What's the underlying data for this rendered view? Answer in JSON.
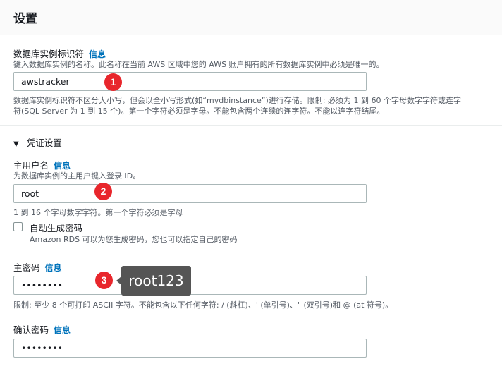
{
  "page": {
    "title": "设置"
  },
  "db_identifier": {
    "label": "数据库实例标识符",
    "info": "信息",
    "hint": "键入数据库实例的名称。此名称在当前 AWS 区域中您的 AWS 账户拥有的所有数据库实例中必须是唯一的。",
    "value": "awstracker",
    "constraint_line1": "数据库实例标识符不区分大小写，但会以全小写形式(如“mydbinstance”)进行存储。限制: 必须为 1 到 60 个字母数字字符或连字",
    "constraint_line2": "符(SQL Server 为 1 到 15 个)。第一个字符必须是字母。不能包含两个连续的连字符。不能以连字符结尾。"
  },
  "credentials": {
    "section_title": "凭证设置",
    "master_username": {
      "label": "主用户名",
      "info": "信息",
      "hint": "为数据库实例的主用户键入登录 ID。",
      "value": "root",
      "constraint": "1 到 16 个字母数字字符。第一个字符必须是字母"
    },
    "auto_generate": {
      "label": "自动生成密码",
      "hint": "Amazon RDS 可以为您生成密码，您也可以指定自己的密码",
      "checked": false
    },
    "master_password": {
      "label": "主密码",
      "info": "信息",
      "value": "••••••••",
      "constraint": "限制: 至少 8 个可打印 ASCII 字符。不能包含以下任何字符: / (斜杠)、' (单引号)、\" (双引号)和 @ (at 符号)。"
    },
    "confirm_password": {
      "label": "确认密码",
      "info": "信息",
      "value": "••••••••"
    }
  },
  "annotations": {
    "badge_1": "1",
    "badge_2": "2",
    "badge_3": "3",
    "tooltip": "root123"
  },
  "colors": {
    "link": "#0073bb",
    "badge": "#e8262c",
    "tooltip_bg": "#555555",
    "header_bg": "#fafafa"
  }
}
